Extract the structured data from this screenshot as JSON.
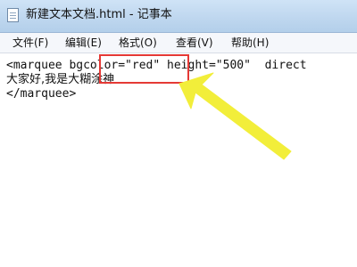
{
  "window": {
    "title": "新建文本文档.html - 记事本",
    "icon": "notepad-icon"
  },
  "menu": {
    "items": [
      "文件(F)",
      "编辑(E)",
      "格式(O)",
      "查看(V)",
      "帮助(H)"
    ]
  },
  "editor": {
    "lines": [
      "<marquee bgcolor=\"red\" height=\"500\"  direct",
      "大家好,我是大糊涂神",
      "</marquee>"
    ]
  },
  "annotation": {
    "highlight_color": "#e53935",
    "arrow_color": "#f2ee3a",
    "highlight_target": "bgcolor=\"red\""
  }
}
